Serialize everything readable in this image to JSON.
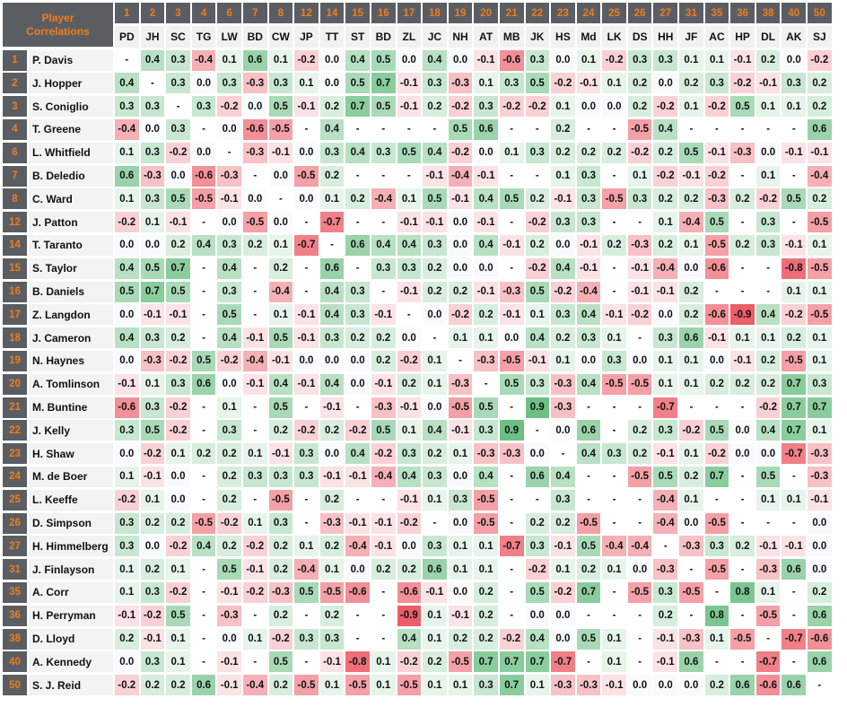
{
  "title_line1": "Player",
  "title_line2": "Correlations",
  "colors": {
    "header_bg": "#5a5e63",
    "accent_orange": "#f07d1e",
    "positive": "#5cb87a",
    "negative": "#ec5a64"
  },
  "columns": [
    {
      "num": "1",
      "abbr": "PD"
    },
    {
      "num": "2",
      "abbr": "JH"
    },
    {
      "num": "3",
      "abbr": "SC"
    },
    {
      "num": "4",
      "abbr": "TG"
    },
    {
      "num": "6",
      "abbr": "LW"
    },
    {
      "num": "7",
      "abbr": "BD"
    },
    {
      "num": "8",
      "abbr": "CW"
    },
    {
      "num": "12",
      "abbr": "JP"
    },
    {
      "num": "14",
      "abbr": "TT"
    },
    {
      "num": "15",
      "abbr": "ST"
    },
    {
      "num": "16",
      "abbr": "BD"
    },
    {
      "num": "17",
      "abbr": "ZL"
    },
    {
      "num": "18",
      "abbr": "JC"
    },
    {
      "num": "19",
      "abbr": "NH"
    },
    {
      "num": "20",
      "abbr": "AT"
    },
    {
      "num": "21",
      "abbr": "MB"
    },
    {
      "num": "22",
      "abbr": "JK"
    },
    {
      "num": "23",
      "abbr": "HS"
    },
    {
      "num": "24",
      "abbr": "Md"
    },
    {
      "num": "25",
      "abbr": "LK"
    },
    {
      "num": "26",
      "abbr": "DS"
    },
    {
      "num": "27",
      "abbr": "HH"
    },
    {
      "num": "31",
      "abbr": "JF"
    },
    {
      "num": "35",
      "abbr": "AC"
    },
    {
      "num": "36",
      "abbr": "HP"
    },
    {
      "num": "38",
      "abbr": "DL"
    },
    {
      "num": "40",
      "abbr": "AK"
    },
    {
      "num": "50",
      "abbr": "SJ"
    }
  ],
  "rows": [
    {
      "num": "1",
      "name": "P. Davis",
      "values": [
        "-",
        "0.4",
        "0.3",
        "-0.4",
        "0.1",
        "0.6",
        "0.1",
        "-0.2",
        "0.0",
        "0.4",
        "0.5",
        "0.0",
        "0.4",
        "0.0",
        "-0.1",
        "-0.6",
        "0.3",
        "0.0",
        "0.1",
        "-0.2",
        "0.3",
        "0.3",
        "0.1",
        "0.1",
        "-0.1",
        "0.2",
        "0.0",
        "-0.2"
      ]
    },
    {
      "num": "2",
      "name": "J. Hopper",
      "values": [
        "0.4",
        "-",
        "0.3",
        "0.0",
        "0.3",
        "-0.3",
        "0.3",
        "0.1",
        "0.0",
        "0.5",
        "0.7",
        "-0.1",
        "0.3",
        "-0.3",
        "0.1",
        "0.3",
        "0.5",
        "-0.2",
        "-0.1",
        "0.1",
        "0.2",
        "0.0",
        "0.2",
        "0.3",
        "-0.2",
        "-0.1",
        "0.3",
        "0.2"
      ]
    },
    {
      "num": "3",
      "name": "S. Coniglio",
      "values": [
        "0.3",
        "0.3",
        "-",
        "0.3",
        "-0.2",
        "0.0",
        "0.5",
        "-0.1",
        "0.2",
        "0.7",
        "0.5",
        "-0.1",
        "0.2",
        "-0.2",
        "0.3",
        "-0.2",
        "-0.2",
        "0.1",
        "0.0",
        "0.0",
        "0.2",
        "-0.2",
        "0.1",
        "-0.2",
        "0.5",
        "0.1",
        "0.1",
        "0.2"
      ]
    },
    {
      "num": "4",
      "name": "T. Greene",
      "values": [
        "-0.4",
        "0.0",
        "0.3",
        "-",
        "0.0",
        "-0.6",
        "-0.5",
        "-",
        "0.4",
        "-",
        "-",
        "-",
        "-",
        "0.5",
        "0.6",
        "-",
        "-",
        "0.2",
        "-",
        "-",
        "-0.5",
        "0.4",
        "-",
        "-",
        "-",
        "-",
        "-",
        "0.6"
      ]
    },
    {
      "num": "6",
      "name": "L. Whitfield",
      "values": [
        "0.1",
        "0.3",
        "-0.2",
        "0.0",
        "-",
        "-0.3",
        "-0.1",
        "0.0",
        "0.3",
        "0.4",
        "0.3",
        "0.5",
        "0.4",
        "-0.2",
        "0.0",
        "0.1",
        "0.3",
        "0.2",
        "0.2",
        "0.2",
        "-0.2",
        "0.2",
        "0.5",
        "-0.1",
        "-0.3",
        "0.0",
        "-0.1",
        "-0.1"
      ]
    },
    {
      "num": "7",
      "name": "B. Deledio",
      "values": [
        "0.6",
        "-0.3",
        "0.0",
        "-0.6",
        "-0.3",
        "-",
        "0.0",
        "-0.5",
        "0.2",
        "-",
        "-",
        "-",
        "-0.1",
        "-0.4",
        "-0.1",
        "-",
        "-",
        "0.1",
        "0.3",
        "-",
        "0.1",
        "-0.2",
        "-0.1",
        "-0.2",
        "-",
        "0.1",
        "-",
        "-0.4"
      ]
    },
    {
      "num": "8",
      "name": "C. Ward",
      "values": [
        "0.1",
        "0.3",
        "0.5",
        "-0.5",
        "-0.1",
        "0.0",
        "-",
        "0.0",
        "0.1",
        "0.2",
        "-0.4",
        "0.1",
        "0.5",
        "-0.1",
        "0.4",
        "0.5",
        "0.2",
        "-0.1",
        "0.3",
        "-0.5",
        "0.3",
        "0.2",
        "0.2",
        "-0.3",
        "0.2",
        "-0.2",
        "0.5",
        "0.2"
      ]
    },
    {
      "num": "12",
      "name": "J. Patton",
      "values": [
        "-0.2",
        "0.1",
        "-0.1",
        "-",
        "0.0",
        "-0.5",
        "0.0",
        "-",
        "-0.7",
        "-",
        "-",
        "-0.1",
        "-0.1",
        "0.0",
        "-0.1",
        "-",
        "-0.2",
        "0.3",
        "0.3",
        "-",
        "-",
        "0.1",
        "-0.4",
        "0.5",
        "-",
        "0.3",
        "-",
        "-0.5"
      ]
    },
    {
      "num": "14",
      "name": "T. Taranto",
      "values": [
        "0.0",
        "0.0",
        "0.2",
        "0.4",
        "0.3",
        "0.2",
        "0.1",
        "-0.7",
        "-",
        "0.6",
        "0.4",
        "0.4",
        "0.3",
        "0.0",
        "0.4",
        "-0.1",
        "0.2",
        "0.0",
        "-0.1",
        "0.2",
        "-0.3",
        "0.2",
        "0.1",
        "-0.5",
        "0.2",
        "0.3",
        "-0.1",
        "0.1"
      ]
    },
    {
      "num": "15",
      "name": "S. Taylor",
      "values": [
        "0.4",
        "0.5",
        "0.7",
        "-",
        "0.4",
        "-",
        "0.2",
        "-",
        "0.6",
        "-",
        "0.3",
        "0.3",
        "0.2",
        "0.0",
        "0.0",
        "-",
        "-0.2",
        "0.4",
        "-0.1",
        "-",
        "-0.1",
        "-0.4",
        "0.0",
        "-0.6",
        "-",
        "-",
        "-0.8",
        "-0.5"
      ]
    },
    {
      "num": "16",
      "name": "B. Daniels",
      "values": [
        "0.5",
        "0.7",
        "0.5",
        "-",
        "0.3",
        "-",
        "-0.4",
        "-",
        "0.4",
        "0.3",
        "-",
        "-0.1",
        "0.2",
        "0.2",
        "-0.1",
        "-0.3",
        "0.5",
        "-0.2",
        "-0.4",
        "-",
        "-0.1",
        "-0.1",
        "0.2",
        "-",
        "-",
        "-",
        "0.1",
        "0.1"
      ]
    },
    {
      "num": "17",
      "name": "Z. Langdon",
      "values": [
        "0.0",
        "-0.1",
        "-0.1",
        "-",
        "0.5",
        "-",
        "0.1",
        "-0.1",
        "0.4",
        "0.3",
        "-0.1",
        "-",
        "0.0",
        "-0.2",
        "0.2",
        "-0.1",
        "0.1",
        "0.3",
        "0.4",
        "-0.1",
        "-0.2",
        "0.0",
        "0.2",
        "-0.6",
        "-0.9",
        "0.4",
        "-0.2",
        "-0.5"
      ]
    },
    {
      "num": "18",
      "name": "J. Cameron",
      "values": [
        "0.4",
        "0.3",
        "0.2",
        "-",
        "0.4",
        "-0.1",
        "0.5",
        "-0.1",
        "0.3",
        "0.2",
        "0.2",
        "0.0",
        "-",
        "0.1",
        "0.1",
        "0.0",
        "0.4",
        "0.2",
        "0.3",
        "0.1",
        "-",
        "0.3",
        "0.6",
        "-0.1",
        "0.1",
        "0.1",
        "0.2",
        "0.1"
      ]
    },
    {
      "num": "19",
      "name": "N. Haynes",
      "values": [
        "0.0",
        "-0.3",
        "-0.2",
        "0.5",
        "-0.2",
        "-0.4",
        "-0.1",
        "0.0",
        "0.0",
        "0.0",
        "0.2",
        "-0.2",
        "0.1",
        "-",
        "-0.3",
        "-0.5",
        "-0.1",
        "0.1",
        "0.0",
        "0.3",
        "0.0",
        "0.1",
        "0.1",
        "0.0",
        "-0.1",
        "0.2",
        "-0.5",
        "0.1"
      ]
    },
    {
      "num": "20",
      "name": "A. Tomlinson",
      "values": [
        "-0.1",
        "0.1",
        "0.3",
        "0.6",
        "0.0",
        "-0.1",
        "0.4",
        "-0.1",
        "0.4",
        "0.0",
        "-0.1",
        "0.2",
        "0.1",
        "-0.3",
        "-",
        "0.5",
        "0.3",
        "-0.3",
        "0.4",
        "-0.5",
        "-0.5",
        "0.1",
        "0.1",
        "0.2",
        "0.2",
        "0.2",
        "0.7",
        "0.3"
      ]
    },
    {
      "num": "21",
      "name": "M. Buntine",
      "values": [
        "-0.6",
        "0.3",
        "-0.2",
        "-",
        "0.1",
        "-",
        "0.5",
        "-",
        "-0.1",
        "-",
        "-0.3",
        "-0.1",
        "0.0",
        "-0.5",
        "0.5",
        "-",
        "0.9",
        "-0.3",
        "-",
        "-",
        "-",
        "-0.7",
        "-",
        "-",
        "-",
        "-0.2",
        "0.7",
        "0.7"
      ]
    },
    {
      "num": "22",
      "name": "J. Kelly",
      "values": [
        "0.3",
        "0.5",
        "-0.2",
        "-",
        "0.3",
        "-",
        "0.2",
        "-0.2",
        "0.2",
        "-0.2",
        "0.5",
        "0.1",
        "0.4",
        "-0.1",
        "0.3",
        "0.9",
        "-",
        "0.0",
        "0.6",
        "-",
        "0.2",
        "0.3",
        "-0.2",
        "0.5",
        "0.0",
        "0.4",
        "0.7",
        "0.1"
      ]
    },
    {
      "num": "23",
      "name": "H. Shaw",
      "values": [
        "0.0",
        "-0.2",
        "0.1",
        "0.2",
        "0.2",
        "0.1",
        "-0.1",
        "0.3",
        "0.0",
        "0.4",
        "-0.2",
        "0.3",
        "0.2",
        "0.1",
        "-0.3",
        "-0.3",
        "0.0",
        "-",
        "0.4",
        "0.3",
        "0.2",
        "-0.1",
        "0.1",
        "-0.2",
        "0.0",
        "0.0",
        "-0.7",
        "-0.3"
      ]
    },
    {
      "num": "24",
      "name": "M. de Boer",
      "values": [
        "0.1",
        "-0.1",
        "0.0",
        "-",
        "0.2",
        "0.3",
        "0.3",
        "0.3",
        "-0.1",
        "-0.1",
        "-0.4",
        "0.4",
        "0.3",
        "0.0",
        "0.4",
        "-",
        "0.6",
        "0.4",
        "-",
        "-",
        "-0.5",
        "0.5",
        "0.2",
        "0.7",
        "-",
        "0.5",
        "-",
        "-0.3"
      ]
    },
    {
      "num": "25",
      "name": "L. Keeffe",
      "values": [
        "-0.2",
        "0.1",
        "0.0",
        "-",
        "0.2",
        "-",
        "-0.5",
        "-",
        "0.2",
        "-",
        "-",
        "-0.1",
        "0.1",
        "0.3",
        "-0.5",
        "-",
        "-",
        "0.3",
        "-",
        "-",
        "-",
        "-0.4",
        "0.1",
        "-",
        "-",
        "0.1",
        "0.1",
        "-0.1"
      ]
    },
    {
      "num": "26",
      "name": "D. Simpson",
      "values": [
        "0.3",
        "0.2",
        "0.2",
        "-0.5",
        "-0.2",
        "0.1",
        "0.3",
        "-",
        "-0.3",
        "-0.1",
        "-0.1",
        "-0.2",
        "-",
        "0.0",
        "-0.5",
        "-",
        "0.2",
        "0.2",
        "-0.5",
        "-",
        "-",
        "-0.4",
        "0.0",
        "-0.5",
        "-",
        "-",
        "-",
        "0.0"
      ]
    },
    {
      "num": "27",
      "name": "H. Himmelberg",
      "values": [
        "0.3",
        "0.0",
        "-0.2",
        "0.4",
        "0.2",
        "-0.2",
        "0.2",
        "0.1",
        "0.2",
        "-0.4",
        "-0.1",
        "0.0",
        "0.3",
        "0.1",
        "0.1",
        "-0.7",
        "0.3",
        "-0.1",
        "0.5",
        "-0.4",
        "-0.4",
        "-",
        "-0.3",
        "0.3",
        "0.2",
        "-0.1",
        "-0.1",
        "0.0"
      ]
    },
    {
      "num": "31",
      "name": "J. Finlayson",
      "values": [
        "0.1",
        "0.2",
        "0.1",
        "-",
        "0.5",
        "-0.1",
        "0.2",
        "-0.4",
        "0.1",
        "0.0",
        "0.2",
        "0.2",
        "0.6",
        "0.1",
        "0.1",
        "-",
        "-0.2",
        "0.1",
        "0.2",
        "0.1",
        "0.0",
        "-0.3",
        "-",
        "-0.5",
        "-",
        "-0.3",
        "0.6",
        "0.0"
      ]
    },
    {
      "num": "35",
      "name": "A. Corr",
      "values": [
        "0.1",
        "0.3",
        "-0.2",
        "-",
        "-0.1",
        "-0.2",
        "-0.3",
        "0.5",
        "-0.5",
        "-0.6",
        "-",
        "-0.6",
        "-0.1",
        "0.0",
        "0.2",
        "-",
        "0.5",
        "-0.2",
        "0.7",
        "-",
        "-0.5",
        "0.3",
        "-0.5",
        "-",
        "0.8",
        "0.1",
        "-",
        "0.2"
      ]
    },
    {
      "num": "36",
      "name": "H. Perryman",
      "values": [
        "-0.1",
        "-0.2",
        "0.5",
        "-",
        "-0.3",
        "-",
        "0.2",
        "-",
        "0.2",
        "-",
        "-",
        "-0.9",
        "0.1",
        "-0.1",
        "0.2",
        "-",
        "0.0",
        "0.0",
        "-",
        "-",
        "-",
        "0.2",
        "-",
        "0.8",
        "-",
        "-0.5",
        "-",
        "0.6"
      ]
    },
    {
      "num": "38",
      "name": "D. Lloyd",
      "values": [
        "0.2",
        "-0.1",
        "0.1",
        "-",
        "0.0",
        "0.1",
        "-0.2",
        "0.3",
        "0.3",
        "-",
        "-",
        "0.4",
        "0.1",
        "0.2",
        "0.2",
        "-0.2",
        "0.4",
        "0.0",
        "0.5",
        "0.1",
        "-",
        "-0.1",
        "-0.3",
        "0.1",
        "-0.5",
        "-",
        "-0.7",
        "-0.6"
      ]
    },
    {
      "num": "40",
      "name": "A. Kennedy",
      "values": [
        "0.0",
        "0.3",
        "0.1",
        "-",
        "-0.1",
        "-",
        "0.5",
        "-",
        "-0.1",
        "-0.8",
        "0.1",
        "-0.2",
        "0.2",
        "-0.5",
        "0.7",
        "0.7",
        "0.7",
        "-0.7",
        "-",
        "0.1",
        "-",
        "-0.1",
        "0.6",
        "-",
        "-",
        "-0.7",
        "-",
        "0.6"
      ]
    },
    {
      "num": "50",
      "name": "S. J. Reid",
      "values": [
        "-0.2",
        "0.2",
        "0.2",
        "0.6",
        "-0.1",
        "-0.4",
        "0.2",
        "-0.5",
        "0.1",
        "-0.5",
        "0.1",
        "-0.5",
        "0.1",
        "0.1",
        "0.3",
        "0.7",
        "0.1",
        "-0.3",
        "-0.3",
        "-0.1",
        "0.0",
        "0.0",
        "0.0",
        "0.2",
        "0.6",
        "-0.6",
        "0.6",
        "-"
      ]
    }
  ]
}
